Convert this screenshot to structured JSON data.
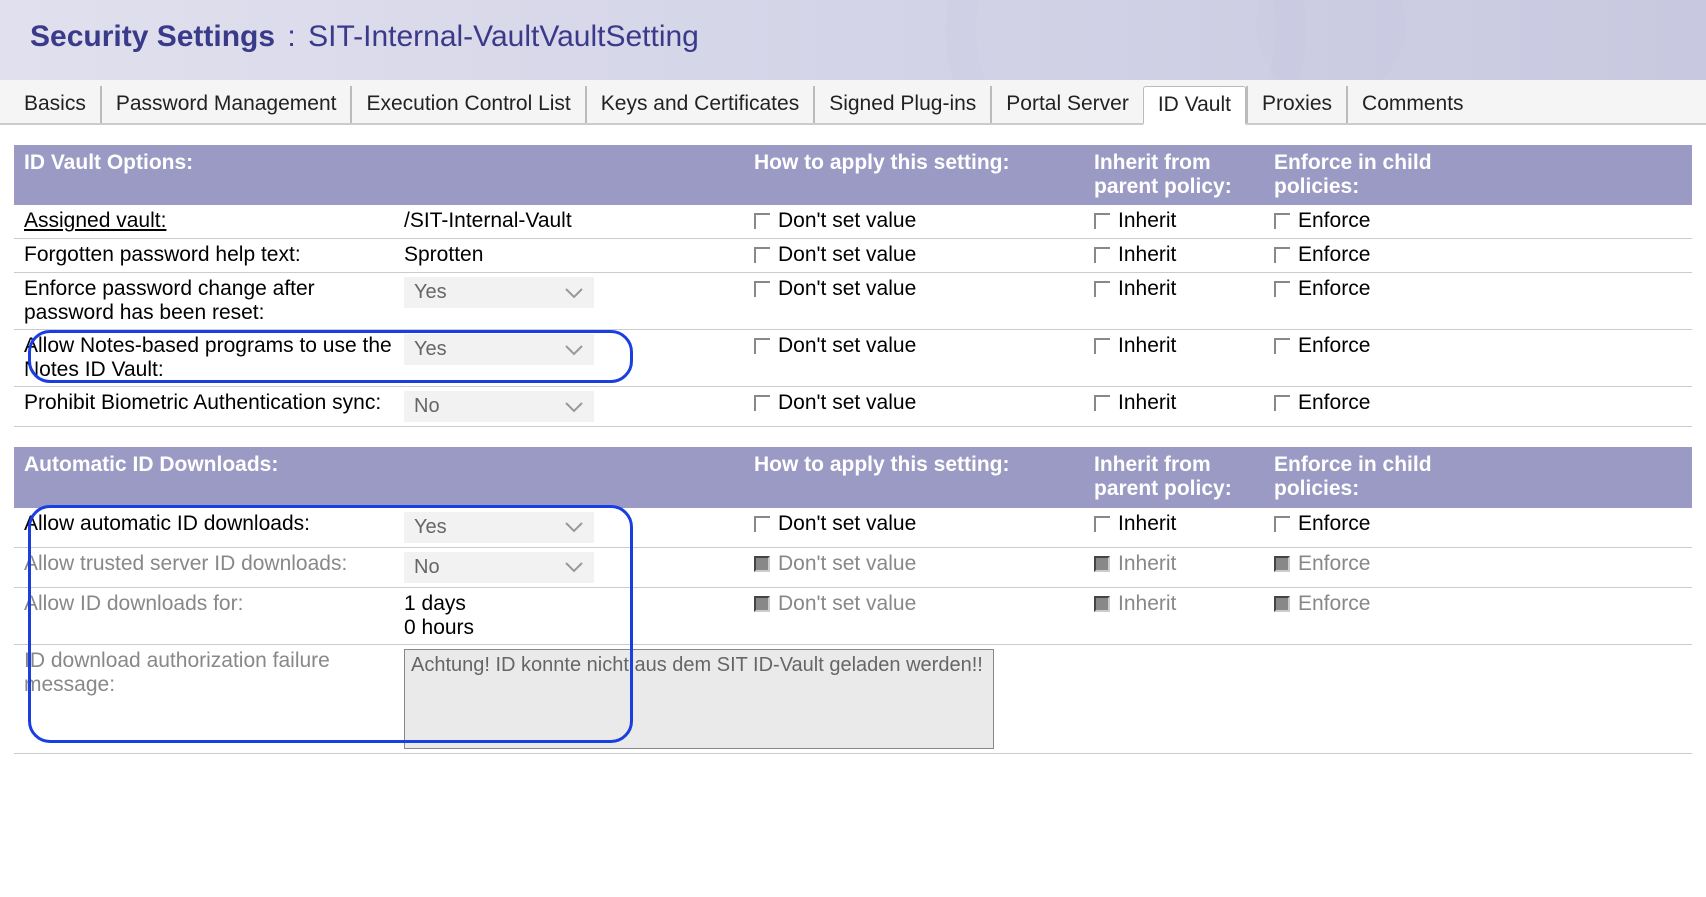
{
  "page": {
    "title_prefix": "Security Settings",
    "title_colon": ":",
    "title_name": "SIT-Internal-VaultVaultSetting"
  },
  "tabs": [
    "Basics",
    "Password Management",
    "Execution Control List",
    "Keys and Certificates",
    "Signed Plug-ins",
    "Portal Server",
    "ID Vault",
    "Proxies",
    "Comments"
  ],
  "active_tab": "ID Vault",
  "headers": {
    "apply": "How to apply this setting:",
    "inherit": "Inherit from parent policy:",
    "enforce": "Enforce in child policies:"
  },
  "sections": {
    "vault_options": {
      "title": "ID Vault Options:",
      "rows": [
        {
          "label": "Assigned vault:",
          "link": true,
          "value": "/SIT-Internal-Vault",
          "type": "text"
        },
        {
          "label": "Forgotten password help text:",
          "value": "Sprotten",
          "type": "text"
        },
        {
          "label": "Enforce password change after password has been reset:",
          "value": "Yes",
          "type": "dropdown"
        },
        {
          "label": "Allow Notes-based programs to use the Notes ID Vault:",
          "value": "Yes",
          "type": "dropdown",
          "highlight": true
        },
        {
          "label": "Prohibit Biometric Authentication sync:",
          "value": "No",
          "type": "dropdown"
        }
      ]
    },
    "auto_downloads": {
      "title": "Automatic ID Downloads:",
      "rows": [
        {
          "label": "Allow automatic ID downloads:",
          "value": "Yes",
          "type": "dropdown"
        },
        {
          "label": "Allow trusted server ID downloads:",
          "value": "No",
          "type": "dropdown",
          "dim": true
        },
        {
          "label": "Allow ID downloads for:",
          "value": "1 days\n0 hours",
          "type": "multiline",
          "dim": true
        },
        {
          "label": "ID download authorization failure message:",
          "value": "Achtung! ID konnte nicht aus dem SIT ID-Vault geladen werden!!",
          "type": "textarea",
          "dim": true
        }
      ]
    }
  },
  "check_labels": {
    "dont_set": "Don't set value",
    "inherit": "Inherit",
    "enforce": "Enforce"
  }
}
